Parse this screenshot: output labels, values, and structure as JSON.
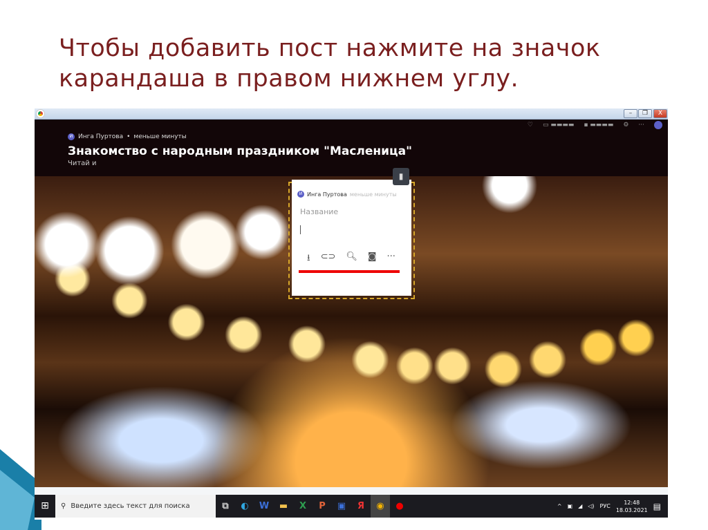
{
  "slide": {
    "title": "Чтобы добавить пост нажмите на значок карандаша в правом нижнем углу."
  },
  "window": {
    "minimize": "–",
    "maximize": "❐",
    "close": "X"
  },
  "post": {
    "author_initial": "И",
    "author": "Инга Пуртова",
    "read_time": "меньше минуты",
    "title": "Знакомство с народным праздником \"Масленица\"",
    "subtitle": "Читай и"
  },
  "editor": {
    "author_initial": "И",
    "author": "Инга Пуртова",
    "read_time": "меньше минуты",
    "title_placeholder": "Название",
    "tools": [
      "upload-icon",
      "link-icon",
      "search-image-icon",
      "camera-icon",
      "more-icon"
    ]
  },
  "taskbar": {
    "search_placeholder": "Введите здесь текст для поиска",
    "lang": "РУС",
    "time": "12:48",
    "date": "18.03.2021",
    "apps": [
      "task-view",
      "edge",
      "word",
      "explorer",
      "excel",
      "powerpoint",
      "save",
      "yandex",
      "chrome",
      "record"
    ]
  },
  "colors": {
    "title": "#7a1f1f",
    "highlight": "#e00000",
    "dashed": "#d8a82a"
  }
}
